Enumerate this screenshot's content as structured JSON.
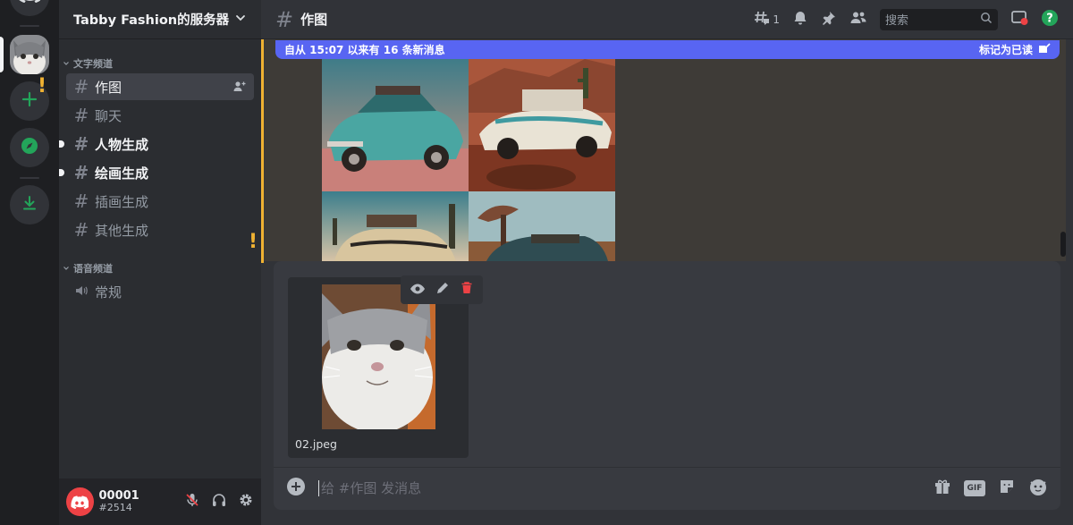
{
  "guild": {
    "name": "Tabby Fashion的服务器"
  },
  "categories": {
    "text": "文字频道",
    "voice": "语音频道"
  },
  "channels": [
    {
      "name": "作图",
      "state": "active"
    },
    {
      "name": "聊天",
      "state": "muted"
    },
    {
      "name": "人物生成",
      "state": "unread"
    },
    {
      "name": "绘画生成",
      "state": "unread"
    },
    {
      "name": "插画生成",
      "state": "muted"
    },
    {
      "name": "其他生成",
      "state": "muted"
    }
  ],
  "voice_channels": [
    {
      "name": "常规"
    }
  ],
  "user": {
    "name": "00001",
    "tag": "#2514"
  },
  "chat": {
    "channel_name": "作图",
    "threads_count": "1",
    "search_placeholder": "搜索",
    "new_messages_banner": "自从 15:07 以来有 16 条新消息",
    "mark_read": "标记为已读"
  },
  "attachment": {
    "filename": "02.jpeg"
  },
  "composer": {
    "placeholder": "给 #作图 发消息",
    "gif_label": "GIF"
  },
  "colors": {
    "accent": "#5865f2",
    "warning": "#f0b232",
    "danger": "#ed4245",
    "help": "#23a55a"
  },
  "icons": [
    "discord-icon",
    "add-server-icon",
    "compass-icon",
    "download-icon",
    "chevron-down-icon",
    "hash-icon",
    "add-member-icon",
    "speaker-icon",
    "mute-mic-icon",
    "headphones-icon",
    "gear-icon",
    "threads-icon",
    "bell-icon",
    "pin-icon",
    "members-icon",
    "search-icon",
    "inbox-icon",
    "help-icon",
    "eye-icon",
    "pencil-icon",
    "trash-icon",
    "plus-circle-icon",
    "gift-icon",
    "sticker-icon",
    "emoji-icon"
  ]
}
